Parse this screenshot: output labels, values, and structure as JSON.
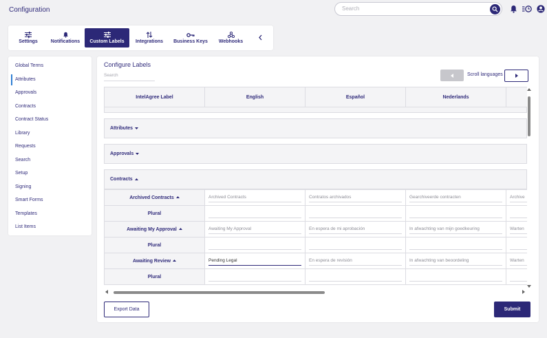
{
  "header": {
    "title": "Configuration",
    "search_placeholder": "Search"
  },
  "tabs": [
    {
      "label": "Settings",
      "icon": "sliders-icon"
    },
    {
      "label": "Notifications",
      "icon": "bell-icon"
    },
    {
      "label": "Custom Labels",
      "icon": "sliders-icon",
      "active": true
    },
    {
      "label": "Integrations",
      "icon": "sort-arrows-icon"
    },
    {
      "label": "Business Keys",
      "icon": "key-icon"
    },
    {
      "label": "Webhooks",
      "icon": "webhook-icon"
    }
  ],
  "sidebar": {
    "items": [
      {
        "label": "Global Terms"
      },
      {
        "label": "Attributes",
        "active": true
      },
      {
        "label": "Approvals"
      },
      {
        "label": "Contracts"
      },
      {
        "label": "Contract Status"
      },
      {
        "label": "Library"
      },
      {
        "label": "Requests"
      },
      {
        "label": "Search"
      },
      {
        "label": "Setup"
      },
      {
        "label": "Signing"
      },
      {
        "label": "Smart Forms"
      },
      {
        "label": "Templates"
      },
      {
        "label": "List Items"
      }
    ]
  },
  "main": {
    "title": "Configure Labels",
    "search_placeholder": "Search",
    "scroll_languages_label": "Scroll languages",
    "columns": [
      "IntelAgree Label",
      "English",
      "Español",
      "Nederlands"
    ],
    "sections": [
      {
        "label": "Attributes"
      },
      {
        "label": "Approvals"
      },
      {
        "label": "Contracts"
      }
    ],
    "rows": [
      {
        "label": "Archived Contracts",
        "values": [
          "Archived Contracts",
          "Contratos archivados",
          "Gearchiveerde contracten",
          "Archive"
        ]
      },
      {
        "label": "Plural",
        "values": [
          "",
          "",
          "",
          ""
        ]
      },
      {
        "label": "Awaiting My Approval",
        "values": [
          "Awaiting My Approval",
          "En espera de mi aprobación",
          "In afwachting van mijn goedkeuring",
          "Warten"
        ]
      },
      {
        "label": "Plural",
        "values": [
          "",
          "",
          "",
          ""
        ]
      },
      {
        "label": "Awaiting Review",
        "values": [
          "Pending Legal",
          "En espera de revisión",
          "In afwachting van beoordeling",
          "Warten"
        ]
      },
      {
        "label": "Plural",
        "values": [
          "",
          "",
          "",
          ""
        ]
      }
    ],
    "export_label": "Export Data",
    "submit_label": "Submit"
  },
  "colors": {
    "primary": "#2c2877",
    "accent": "#2f7fd3",
    "background": "#f1f1f3"
  }
}
